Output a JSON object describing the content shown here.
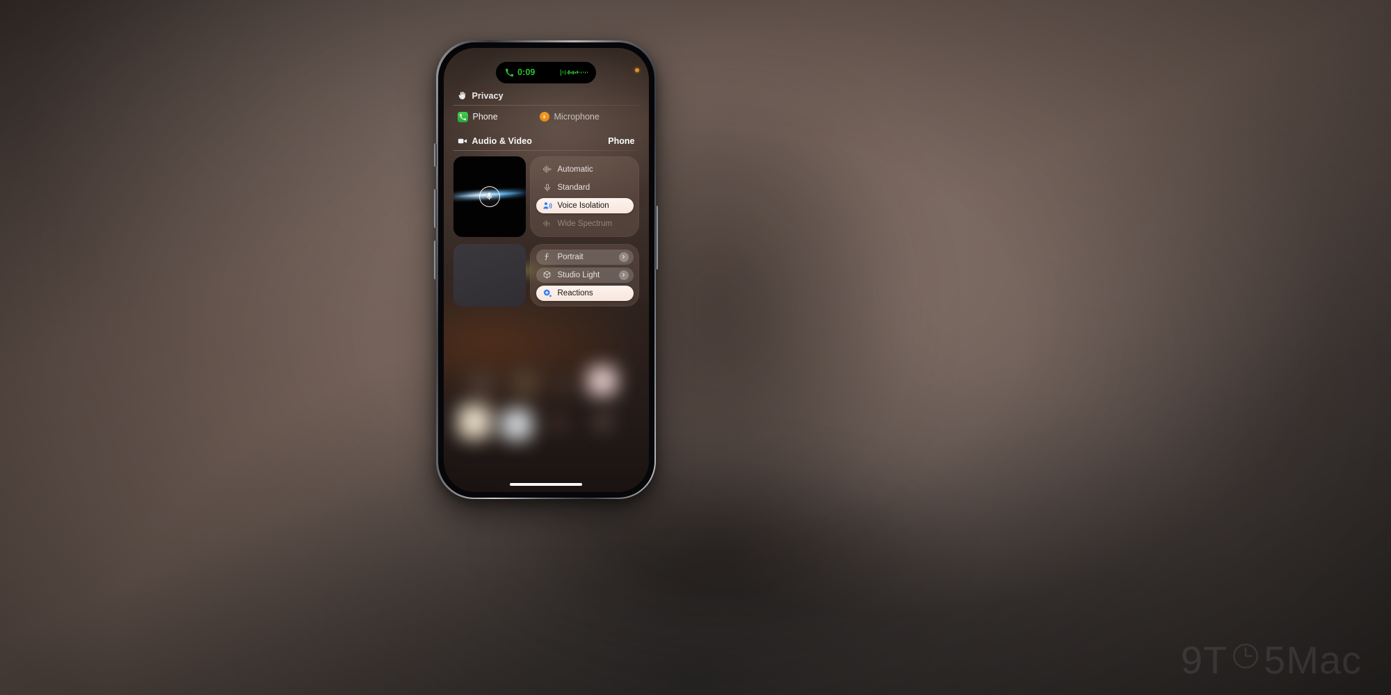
{
  "device": {
    "name": "iPhone",
    "status_island": {
      "icon": "phone-call-icon",
      "timer": "0:09",
      "waveform_icon": "audio-waveform-icon"
    },
    "privacy_indicator": {
      "name": "microphone-privacy-dot",
      "color": "#f59e22"
    },
    "home_indicator": "home-indicator",
    "side_buttons": [
      "action-button",
      "volume-up-button",
      "volume-down-button",
      "power-button"
    ]
  },
  "control_center": {
    "privacy": {
      "icon": "raised-hand-icon",
      "title": "Privacy",
      "items": [
        {
          "icon": "phone-app-icon",
          "label": "Phone",
          "dim": false
        },
        {
          "icon": "microphone-icon",
          "label": "Microphone",
          "dim": true
        }
      ]
    },
    "audio_video": {
      "icon": "video-camera-icon",
      "title": "Audio & Video",
      "source_app": "Phone",
      "mic_module": {
        "preview": {
          "name": "mic-preview-tile",
          "icon": "microphone-circle-icon",
          "background": "#020202",
          "accent": "#7ec8ff"
        },
        "options": [
          {
            "icon": "waveform-icon",
            "label": "Automatic",
            "state": "plain"
          },
          {
            "icon": "microphone-icon",
            "label": "Standard",
            "state": "plain"
          },
          {
            "icon": "voice-isolation-icon",
            "label": "Voice Isolation",
            "state": "active"
          },
          {
            "icon": "wide-spectrum-icon",
            "label": "Wide Spectrum",
            "state": "disabled"
          }
        ]
      },
      "video_module": {
        "preview": {
          "name": "video-preview-tile",
          "background": "#35323a"
        },
        "options": [
          {
            "icon": "portrait-f-icon",
            "label": "Portrait",
            "state": "grey",
            "chevron": true
          },
          {
            "icon": "studio-light-icon",
            "label": "Studio Light",
            "state": "grey",
            "chevron": true
          },
          {
            "icon": "reactions-icon",
            "label": "Reactions",
            "state": "active",
            "chevron": false
          }
        ]
      }
    }
  },
  "watermark": {
    "prefix": "9T",
    "glyph": "clock-icon",
    "suffix": "5Mac"
  },
  "colors": {
    "accent_blue": "#2f7cf6",
    "green": "#31d63a",
    "orange": "#f59e22",
    "pill_active_bg": "#fbeee7"
  }
}
